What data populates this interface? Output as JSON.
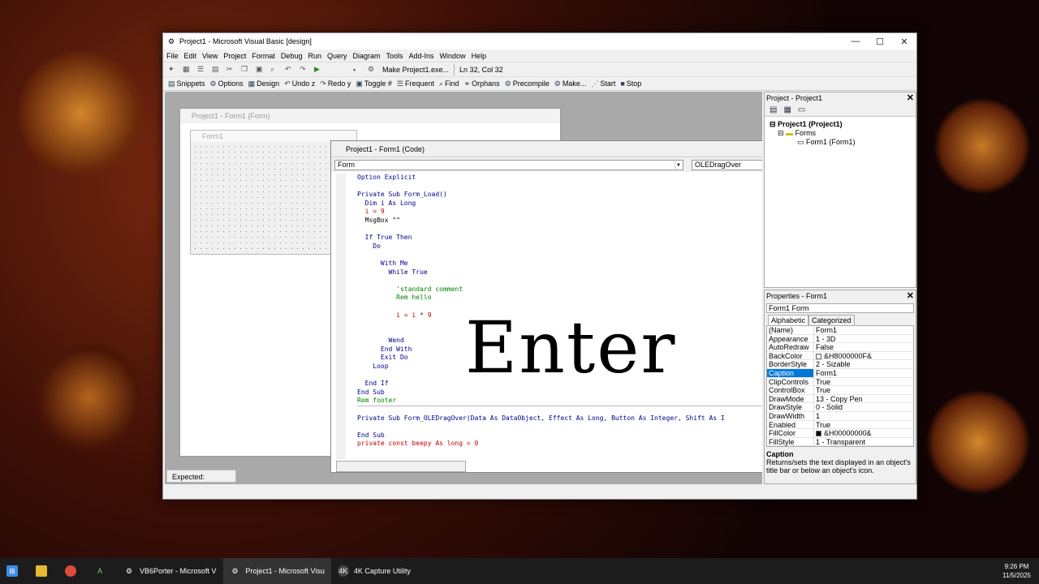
{
  "window": {
    "title": "Project1 - Microsoft Visual Basic [design]"
  },
  "menu": [
    "File",
    "Edit",
    "View",
    "Project",
    "Format",
    "Debug",
    "Run",
    "Query",
    "Diagram",
    "Tools",
    "Add-Ins",
    "Window",
    "Help"
  ],
  "toolbar1": {
    "make_label": "Make Project1.exe...",
    "position": "Ln 32, Col 32"
  },
  "toolbar2": [
    "Snippets",
    "Options",
    "Design",
    "Undo z",
    "Redo y",
    "Toggle #",
    "Frequent",
    "Find",
    "Orphans",
    "Precompile",
    "Make...",
    "Start",
    "Stop"
  ],
  "designer": {
    "title": "Project1 - Form1 (Form)",
    "form_caption": "Form1"
  },
  "codewin": {
    "title": "Project1 - Form1 (Code)",
    "object_combo": "Form",
    "proc_combo": "OLEDragOver",
    "lines": [
      "Option Explicit",
      "",
      "Private Sub Form_Load()",
      "  Dim i As Long",
      "  i = 9",
      "  MsgBox \"\"",
      "",
      "  If True Then",
      "    Do",
      "",
      "      With Me",
      "        While True",
      "",
      "          'standard comment",
      "          Rem hello",
      "",
      "          i = i * 9",
      "",
      "",
      "        Wend",
      "      End With",
      "      Exit Do",
      "    Loop",
      "",
      "  End If",
      "End Sub",
      "Rem footer",
      "",
      "Private Sub Form_OLEDragOver(Data As DataObject, Effect As Long, Button As Integer, Shift As I",
      "",
      "End Sub",
      "private const beepy As long = 0"
    ]
  },
  "overlay_text": "Enter",
  "status": "Expected: expression",
  "project": {
    "title": "Project - Project1",
    "close": "✕",
    "root": "Project1 (Project1)",
    "folder": "Forms",
    "item": "Form1 (Form1)"
  },
  "properties": {
    "title": "Properties - Form1",
    "close": "✕",
    "object": "Form1 Form",
    "tab_alpha": "Alphabetic",
    "tab_cat": "Categorized",
    "rows": [
      {
        "name": "(Name)",
        "value": "Form1"
      },
      {
        "name": "Appearance",
        "value": "1 - 3D"
      },
      {
        "name": "AutoRedraw",
        "value": "False"
      },
      {
        "name": "BackColor",
        "value": "&H8000000F&"
      },
      {
        "name": "BorderStyle",
        "value": "2 - Sizable"
      },
      {
        "name": "Caption",
        "value": "Form1"
      },
      {
        "name": "ClipControls",
        "value": "True"
      },
      {
        "name": "ControlBox",
        "value": "True"
      },
      {
        "name": "DrawMode",
        "value": "13 - Copy Pen"
      },
      {
        "name": "DrawStyle",
        "value": "0 - Solid"
      },
      {
        "name": "DrawWidth",
        "value": "1"
      },
      {
        "name": "Enabled",
        "value": "True"
      },
      {
        "name": "FillColor",
        "value": "&H00000000&"
      },
      {
        "name": "FillStyle",
        "value": "1 - Transparent"
      }
    ],
    "desc_title": "Caption",
    "desc_text": "Returns/sets the text displayed in an object's title bar or below an object's icon."
  },
  "taskbar": {
    "items": [
      "VB6Porter - Microsoft V",
      "Project1 - Microsoft Visu",
      "4K Capture Utility"
    ],
    "time": "9:26 PM",
    "date": "11/5/2025"
  },
  "colors": {
    "selection": "#0078d7",
    "keyword": "#00008b",
    "comment": "#008000",
    "number": "#c00000"
  }
}
